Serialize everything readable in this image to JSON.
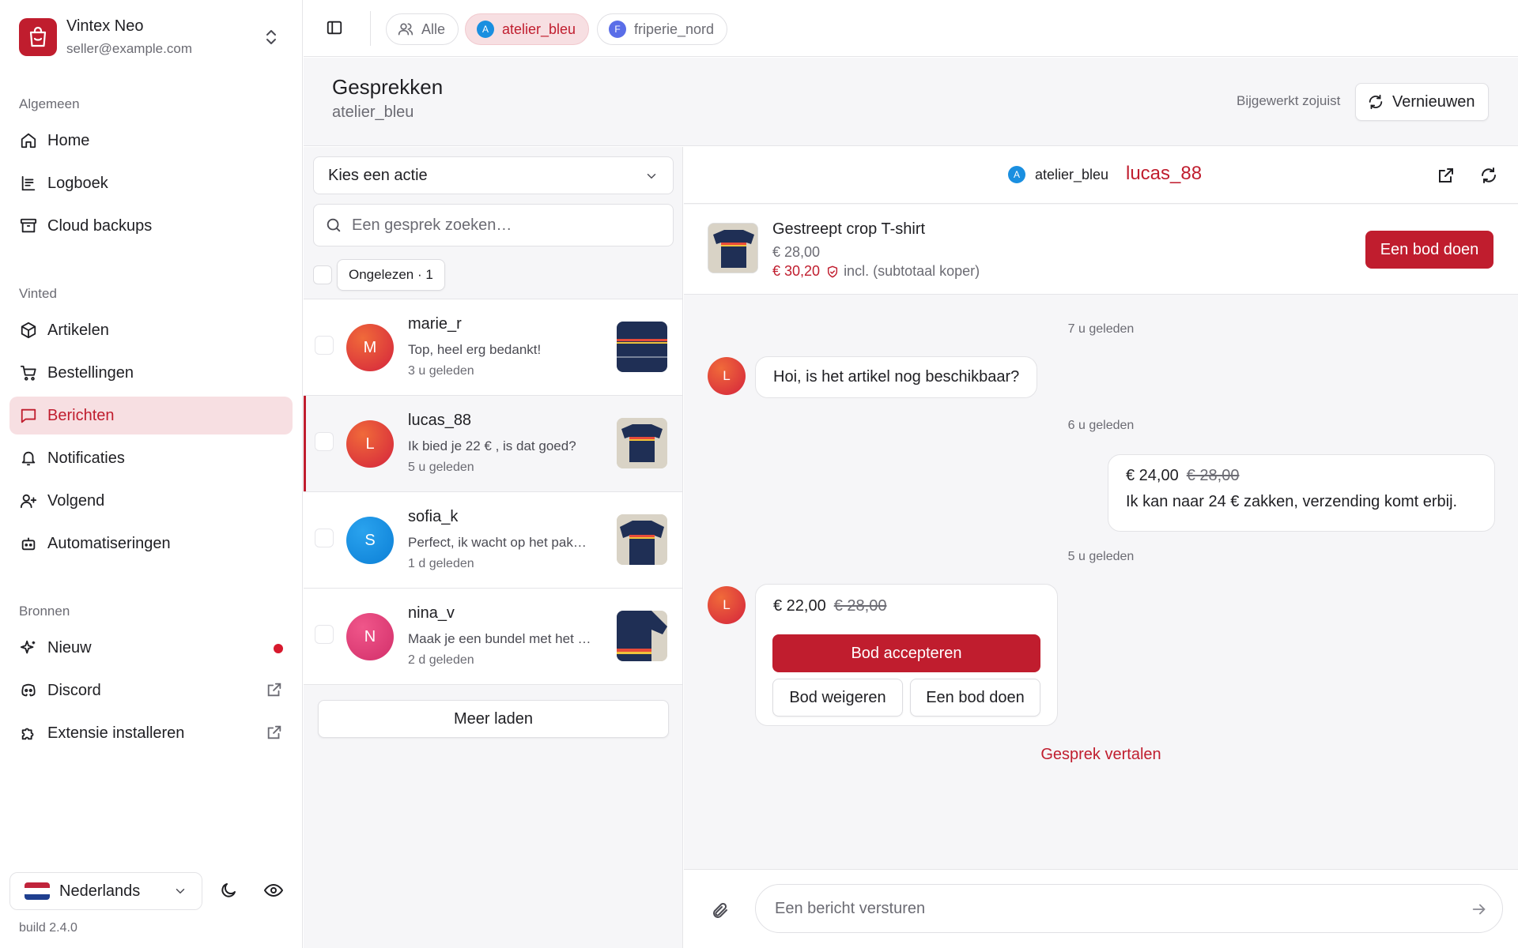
{
  "account": {
    "name": "Vintex Neo",
    "email": "seller@example.com"
  },
  "sidebar": {
    "sections": [
      {
        "title": "Algemeen",
        "items": [
          {
            "label": "Home",
            "icon": "home-icon"
          },
          {
            "label": "Logboek",
            "icon": "logbook-icon"
          },
          {
            "label": "Cloud backups",
            "icon": "archive-icon"
          }
        ]
      },
      {
        "title": "Vinted",
        "items": [
          {
            "label": "Artikelen",
            "icon": "box-icon"
          },
          {
            "label": "Bestellingen",
            "icon": "cart-icon"
          },
          {
            "label": "Berichten",
            "icon": "message-icon",
            "active": true
          },
          {
            "label": "Notificaties",
            "icon": "bell-icon"
          },
          {
            "label": "Volgend",
            "icon": "user-plus-icon"
          },
          {
            "label": "Automatiseringen",
            "icon": "bot-icon"
          }
        ]
      },
      {
        "title": "Bronnen",
        "items": [
          {
            "label": "Nieuw",
            "icon": "sparkles-icon",
            "badge": "dot"
          },
          {
            "label": "Discord",
            "icon": "discord-icon",
            "external": true
          },
          {
            "label": "Extensie installeren",
            "icon": "puzzle-icon",
            "external": true
          }
        ]
      }
    ],
    "language": "Nederlands",
    "build": "build 2.4.0"
  },
  "topbar": {
    "chips": [
      {
        "label": "Alle",
        "icon": "users-icon"
      },
      {
        "label": "atelier_bleu",
        "avatar": "A",
        "active": true
      },
      {
        "label": "friperie_nord",
        "avatar": "F"
      }
    ]
  },
  "page": {
    "title": "Gesprekken",
    "subtitle": "atelier_bleu",
    "updated": "Bijgewerkt zojuist",
    "refresh_label": "Vernieuwen"
  },
  "conversations": {
    "action_select": "Kies een actie",
    "search_placeholder": "Een gesprek zoeken…",
    "unread_filter": "Ongelezen · 1",
    "items": [
      {
        "initial": "M",
        "user": "marie_r",
        "preview": "Top, heel erg bedankt!",
        "time": "3 u geleden"
      },
      {
        "initial": "L",
        "user": "lucas_88",
        "preview": "Ik bied je 22 € , is dat goed?",
        "time": "5 u geleden",
        "active": true
      },
      {
        "initial": "S",
        "user": "sofia_k",
        "preview": "Perfect, ik wacht op het pak…",
        "time": "1 d geleden"
      },
      {
        "initial": "N",
        "user": "nina_v",
        "preview": "Maak je een bundel met het …",
        "time": "2 d geleden"
      }
    ],
    "load_more": "Meer laden"
  },
  "chat": {
    "shop": "atelier_bleu",
    "shop_initial": "A",
    "user": "lucas_88",
    "product": {
      "title": "Gestreept crop T-shirt",
      "price": "€ 28,00",
      "total": "€ 30,20",
      "total_note": "incl. (subtotaal koper)",
      "offer_button": "Een bod doen"
    },
    "messages": [
      {
        "time": "7 u geleden",
        "from": "L",
        "text": "Hoi, is het artikel nog beschikbaar?"
      },
      {
        "time": "6 u geleden",
        "offer": "€ 24,00",
        "original": "€ 28,00",
        "text": "Ik kan naar 24 € zakken, verzending komt erbij."
      },
      {
        "time": "5 u geleden",
        "from": "L",
        "offer": "€ 22,00",
        "original": "€ 28,00",
        "accept": "Bod accepteren",
        "decline": "Bod weigeren",
        "counter": "Een bod doen"
      }
    ],
    "translate": "Gesprek vertalen",
    "composer_placeholder": "Een bericht versturen"
  },
  "colors": {
    "accent": "#c01d2e",
    "accent_soft": "#f7dfe2",
    "background": "#f6f6f8"
  }
}
